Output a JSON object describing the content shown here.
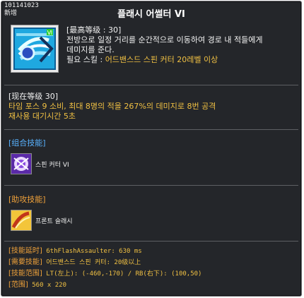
{
  "header": {
    "id_text": "101141023",
    "new_text": "新增",
    "title": "플래시 어썰터 VI"
  },
  "skill": {
    "max_level_line": "[最高等级 : 30]",
    "description": [
      "전방으로 일정 거리를 순간적으로 이동하여 경로 내 적들에게",
      "데미지를 준다."
    ],
    "required_label": "필요 스킬 : ",
    "required_value": "어드밴스드 스핀 커터 20레벨 이상",
    "icon": "flash-assaulter-skill-icon"
  },
  "current": {
    "level_line": "[现在等级 30]",
    "effect_prefix": "타임 포스 9 소비, 최대 8명의 적을 267%의 데미지로 8번 공격",
    "cooldown": "재사용 대기시간 5초"
  },
  "combo": {
    "section_label": "[组合技能]",
    "skill_name": "스핀 커터 VI",
    "icon": "spin-cutter-skill-icon"
  },
  "assist": {
    "section_label": "[助攻技能]",
    "skill_name": "프론트 슬래시",
    "icon": "front-slash-skill-icon"
  },
  "info": [
    {
      "label": "[技能延时]",
      "value": " 6thFlashAssaulter: 630 ms"
    },
    {
      "label": "[需要技能]",
      "value": " 어드밴스드 스핀 커터: 20级以上"
    },
    {
      "label": "[技能范围]",
      "value": " LT(左上): (-460,-170) / RB(右下): (100,50)"
    },
    {
      "label": "[范围]",
      "value": " 560 x 220"
    }
  ],
  "colors": {
    "background": "#24262a",
    "text": "#f2f2f2",
    "yellow": "#f0c043",
    "blue_label": "#58b2ff",
    "orange_label": "#f0a23a"
  }
}
